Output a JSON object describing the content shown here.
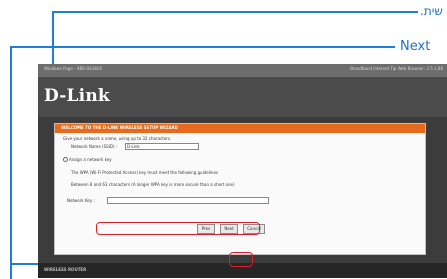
{
  "callouts": {
    "top_label": "שית.",
    "next_label": "Next"
  },
  "window": {
    "title": "Windows Page - ABR-DES605",
    "right_info": "Broadband Internet Tip Web Browser: 2.5.1.86"
  },
  "brand": {
    "logo": "D-Link"
  },
  "wizard": {
    "title": "WELCOME TO THE D-LINK WIRELESS SETUP WIZARD",
    "intro": "Give your network a name, using up to 32 characters.",
    "network_name_label": "Network Name (SSID) :",
    "network_name_value": "D-Link",
    "assign_option": "Assign a network key",
    "wpa_note": "The WPA (Wi-Fi Protected Access) key must meet the following guidelines",
    "length_note": "Between 8 and 63 characters (A longer WPA key is more secure than a short one)",
    "network_key_label": "Network Key :",
    "network_key_value": "",
    "buttons": {
      "prev": "Prev",
      "next": "Next",
      "cancel": "Cancel"
    }
  },
  "footer": {
    "text": "WIRELESS ROUTER"
  },
  "colors": {
    "callout_line": "#1f7fd6",
    "highlight": "#d8202a",
    "wizard_header": "#e86a1c"
  }
}
